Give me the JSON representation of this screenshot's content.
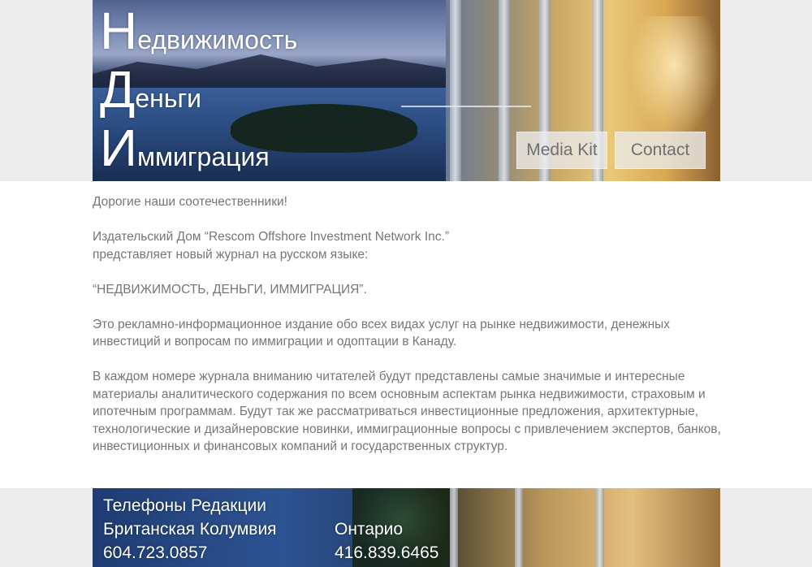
{
  "header": {
    "title_lines": [
      {
        "cap": "Н",
        "rest": "едвижимость"
      },
      {
        "cap": "Д",
        "rest": "еньги"
      },
      {
        "cap": "И",
        "rest": "ммиграция"
      }
    ],
    "nav": {
      "media_kit": "Media Kit",
      "contact": "Contact"
    }
  },
  "content": {
    "greeting": "Дорогие наши соотечественники!",
    "publisher_line1": "Издательский Дом “Rescom Offshore Investment Network Inc.”",
    "publisher_line2": "представляет новый журнал на русском языке:",
    "magazine_name": " “НЕДВИЖИМОСТЬ, ДЕНЬГИ, ИММИГРАЦИЯ”.",
    "about": "Это рекламно-информационное издание обо всех видах услуг на рынке недвижимости, денежных инвестиций и вопросам по иммиграции и одоптации в Канаду.",
    "issue_description": "В каждом номере журнала вниманию читателей будут представлены самые значимые и интересные материалы аналитического содержания по всем основным аспектам рынка недвижимости, страховым и ипотечным программам. Будут так же рассматриваться инвестиционные предложения, архитектурные, технологические и дизайнеровские новинки, иммиграционные вопросы с привлечением экспертов, банков, инвестиционных и финансовых компаний и государственных структур."
  },
  "footer": {
    "phones_heading": "Телефоны Редакции",
    "bc": {
      "region": "Британская Колумвия",
      "phone": "604.723.0857"
    },
    "ontario": {
      "region": "Онтарио",
      "phone": "416.839.6465"
    }
  }
}
